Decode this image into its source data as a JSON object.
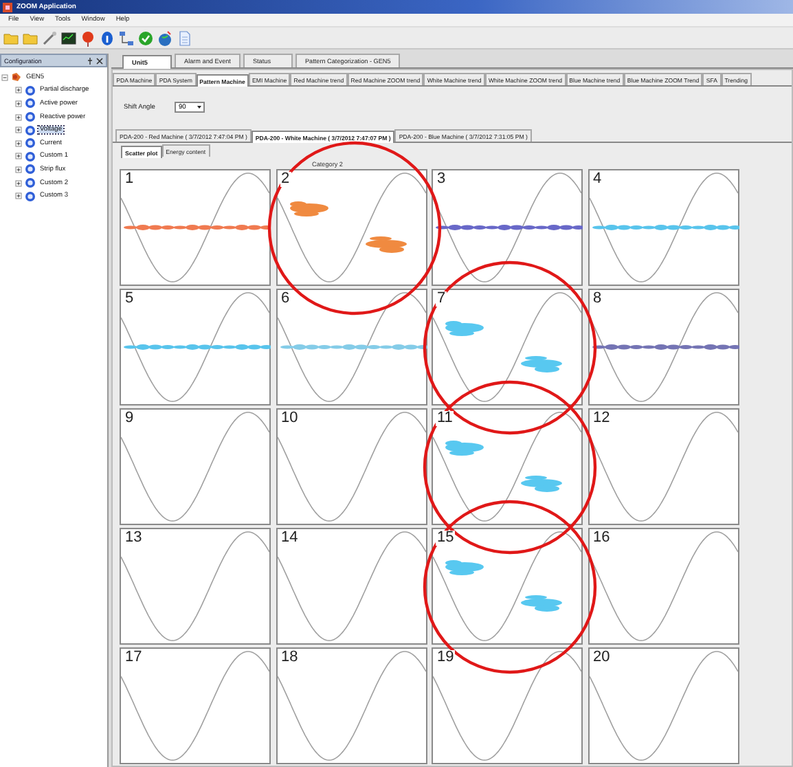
{
  "window": {
    "title": "ZOOM Application"
  },
  "menu": [
    "File",
    "View",
    "Tools",
    "Window",
    "Help"
  ],
  "configuration": {
    "title": "Configuration",
    "tree": [
      {
        "label": "GEN5",
        "expanded": true,
        "selected": false,
        "children": [
          {
            "label": "Partial discharge",
            "expanded": false,
            "selected": false
          },
          {
            "label": "Active power",
            "expanded": false,
            "selected": false
          },
          {
            "label": "Reactive power",
            "expanded": false,
            "selected": false
          },
          {
            "label": "Voltage",
            "expanded": false,
            "selected": true
          },
          {
            "label": "Current",
            "expanded": false,
            "selected": false
          },
          {
            "label": "Custom 1",
            "expanded": false,
            "selected": false
          },
          {
            "label": "Strip flux",
            "expanded": false,
            "selected": false
          },
          {
            "label": "Custom 2",
            "expanded": false,
            "selected": false
          },
          {
            "label": "Custom 3",
            "expanded": false,
            "selected": false
          }
        ]
      }
    ]
  },
  "unit_tabs": [
    {
      "label": "Unit5",
      "selected": true
    },
    {
      "label": "Alarm and Event",
      "selected": false
    },
    {
      "label": "Status",
      "selected": false
    },
    {
      "label": "Pattern Categorization - GEN5",
      "selected": false
    }
  ],
  "view_tabs": [
    {
      "label": "PDA Machine",
      "selected": false
    },
    {
      "label": "PDA System",
      "selected": false
    },
    {
      "label": "Pattern Machine",
      "selected": true
    },
    {
      "label": "EMI Machine",
      "selected": false
    },
    {
      "label": "Red Machine trend",
      "selected": false
    },
    {
      "label": "Red Machine ZOOM trend",
      "selected": false
    },
    {
      "label": "White Machine trend",
      "selected": false
    },
    {
      "label": "White Machine ZOOM trend",
      "selected": false
    },
    {
      "label": "Blue Machine trend",
      "selected": false
    },
    {
      "label": "Blue Machine ZOOM Trend",
      "selected": false
    },
    {
      "label": "SFA",
      "selected": false
    },
    {
      "label": "Trending",
      "selected": false
    }
  ],
  "shift_angle": {
    "label": "Shift Angle",
    "value": "90"
  },
  "machine_tabs": [
    {
      "label": "PDA-200 - Red Machine ( 3/7/2012 7:47:04 PM )",
      "selected": false
    },
    {
      "label": "PDA-200 - White Machine ( 3/7/2012 7:47:07 PM )",
      "selected": true
    },
    {
      "label": "PDA-200 - Blue Machine ( 3/7/2012 7:31:05 PM )",
      "selected": false
    }
  ],
  "plot_tabs": [
    {
      "label": "Scatter plot",
      "selected": true
    },
    {
      "label": "Energy content",
      "selected": false
    }
  ],
  "scatter": {
    "category": "Category 2",
    "cells": [
      {
        "number": "1",
        "kind": "band",
        "color": "#f07a50",
        "circled": false
      },
      {
        "number": "2",
        "kind": "split",
        "color": "#f08a40",
        "circled": true
      },
      {
        "number": "3",
        "kind": "band",
        "color": "#6868c8",
        "circled": false
      },
      {
        "number": "4",
        "kind": "band",
        "color": "#58c4ec",
        "circled": false
      },
      {
        "number": "5",
        "kind": "band",
        "color": "#58c4ec",
        "circled": false
      },
      {
        "number": "6",
        "kind": "band",
        "color": "#84cce8",
        "circled": false
      },
      {
        "number": "7",
        "kind": "split",
        "color": "#58c8f0",
        "circled": true
      },
      {
        "number": "8",
        "kind": "band",
        "color": "#7474b4",
        "circled": false
      },
      {
        "number": "9",
        "kind": "empty",
        "circled": false
      },
      {
        "number": "10",
        "kind": "empty",
        "circled": false
      },
      {
        "number": "11",
        "kind": "split",
        "color": "#58c8f0",
        "circled": true
      },
      {
        "number": "12",
        "kind": "empty",
        "circled": false
      },
      {
        "number": "13",
        "kind": "empty",
        "circled": false
      },
      {
        "number": "14",
        "kind": "empty",
        "circled": false
      },
      {
        "number": "15",
        "kind": "split",
        "color": "#58c8f0",
        "circled": true
      },
      {
        "number": "16",
        "kind": "empty",
        "circled": false
      },
      {
        "number": "17",
        "kind": "empty",
        "circled": false
      },
      {
        "number": "18",
        "kind": "empty",
        "circled": false
      },
      {
        "number": "19",
        "kind": "empty",
        "circled": false
      },
      {
        "number": "20",
        "kind": "empty",
        "circled": false
      }
    ]
  }
}
